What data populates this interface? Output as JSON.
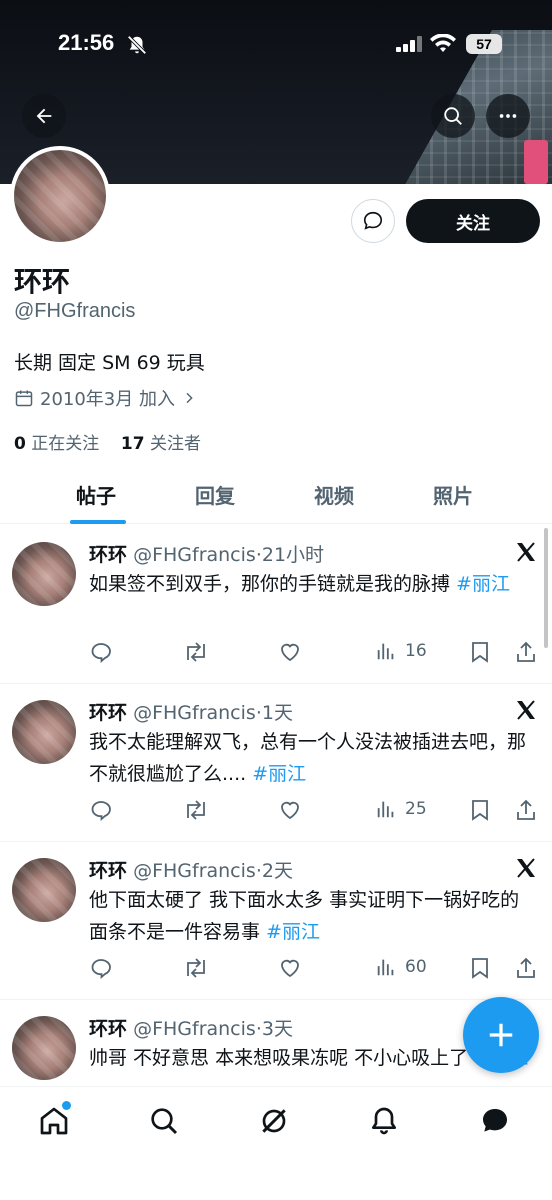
{
  "status_bar": {
    "time": "21:56",
    "battery": "57"
  },
  "profile": {
    "name": "环环",
    "handle": "@FHGfrancis",
    "bio": "长期 固定 SM 69 玩具",
    "joined": "2010年3月 加入",
    "following_count": "0",
    "following_label": "正在关注",
    "followers_count": "17",
    "followers_label": "关注者",
    "follow_button": "关注"
  },
  "tabs": [
    "帖子",
    "回复",
    "视频",
    "照片"
  ],
  "posts": [
    {
      "name": "环环",
      "handle": "@FHGfrancis",
      "time": "21小时",
      "text": "如果签不到双手，那你的手链就是我的脉搏 ",
      "hashtag": "#丽江",
      "views": "16"
    },
    {
      "name": "环环",
      "handle": "@FHGfrancis",
      "time": "1天",
      "text": "我不太能理解双飞，总有一个人没法被插进去吧，那不就很尴尬了么.... ",
      "hashtag": "#丽江",
      "views": "25"
    },
    {
      "name": "环环",
      "handle": "@FHGfrancis",
      "time": "2天",
      "text": "他下面太硬了 我下面水太多 事实证明下一锅好吃的面条不是一件容易事 ",
      "hashtag": "#丽江",
      "views": "60"
    },
    {
      "name": "环环",
      "handle": "@FHGfrancis",
      "time": "3天",
      "text": "帅哥 不好意思 本来想吸果冻呢 不小心吸上了 ",
      "hashtag": "#丽江",
      "views": ""
    }
  ],
  "icons": {
    "back": "arrow-left-icon",
    "search": "search-icon",
    "more": "more-icon",
    "message": "message-icon",
    "calendar": "calendar-icon",
    "x_logo": "x-logo-icon",
    "reply": "reply-icon",
    "repost": "repost-icon",
    "like": "heart-icon",
    "views": "views-icon",
    "bookmark": "bookmark-icon",
    "share": "share-icon",
    "compose": "plus-icon",
    "nav_home": "home-icon",
    "nav_search": "search-icon",
    "nav_grok": "grok-icon",
    "nav_notifications": "bell-icon",
    "nav_messages": "messages-icon"
  },
  "colors": {
    "accent": "#1d9bf0",
    "text": "#0f1419",
    "secondary": "#536471"
  }
}
